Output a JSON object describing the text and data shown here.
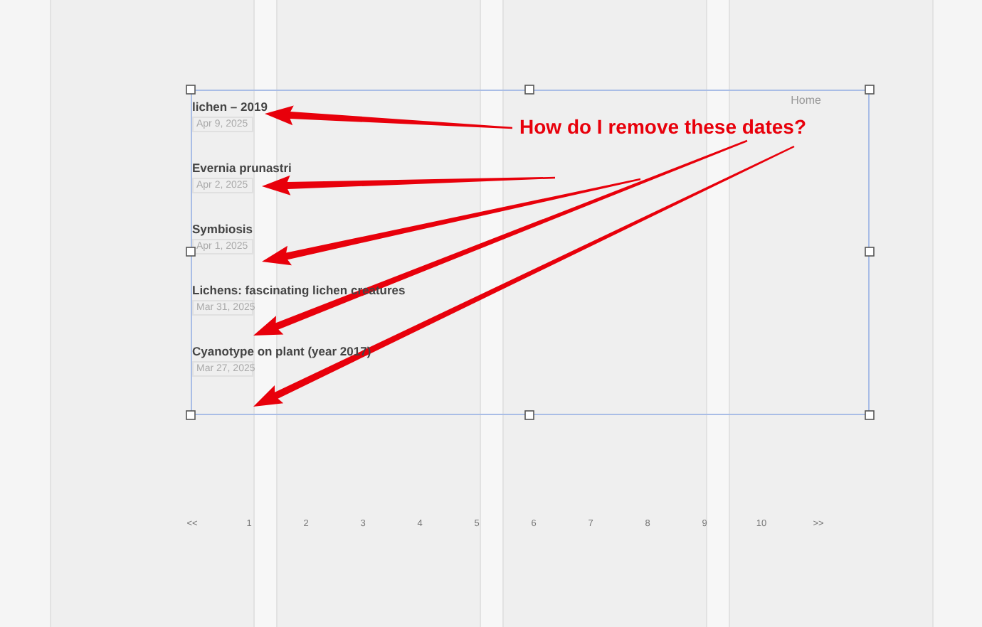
{
  "header": {
    "home_link": "Home"
  },
  "posts": [
    {
      "title": "lichen – 2019",
      "date": "Apr 9, 2025"
    },
    {
      "title": "Evernia prunastri",
      "date": "Apr 2, 2025"
    },
    {
      "title": "Symbiosis",
      "date": "Apr 1, 2025"
    },
    {
      "title": "Lichens: fascinating lichen creatures",
      "date": "Mar 31, 2025"
    },
    {
      "title": "Cyanotype on plant (year 2017)",
      "date": "Mar 27, 2025"
    }
  ],
  "pagination": [
    "<<",
    "1",
    "2",
    "3",
    "4",
    "5",
    "6",
    "7",
    "8",
    "9",
    "10",
    ">>"
  ],
  "annotation": {
    "text": "How do I remove these dates?"
  }
}
